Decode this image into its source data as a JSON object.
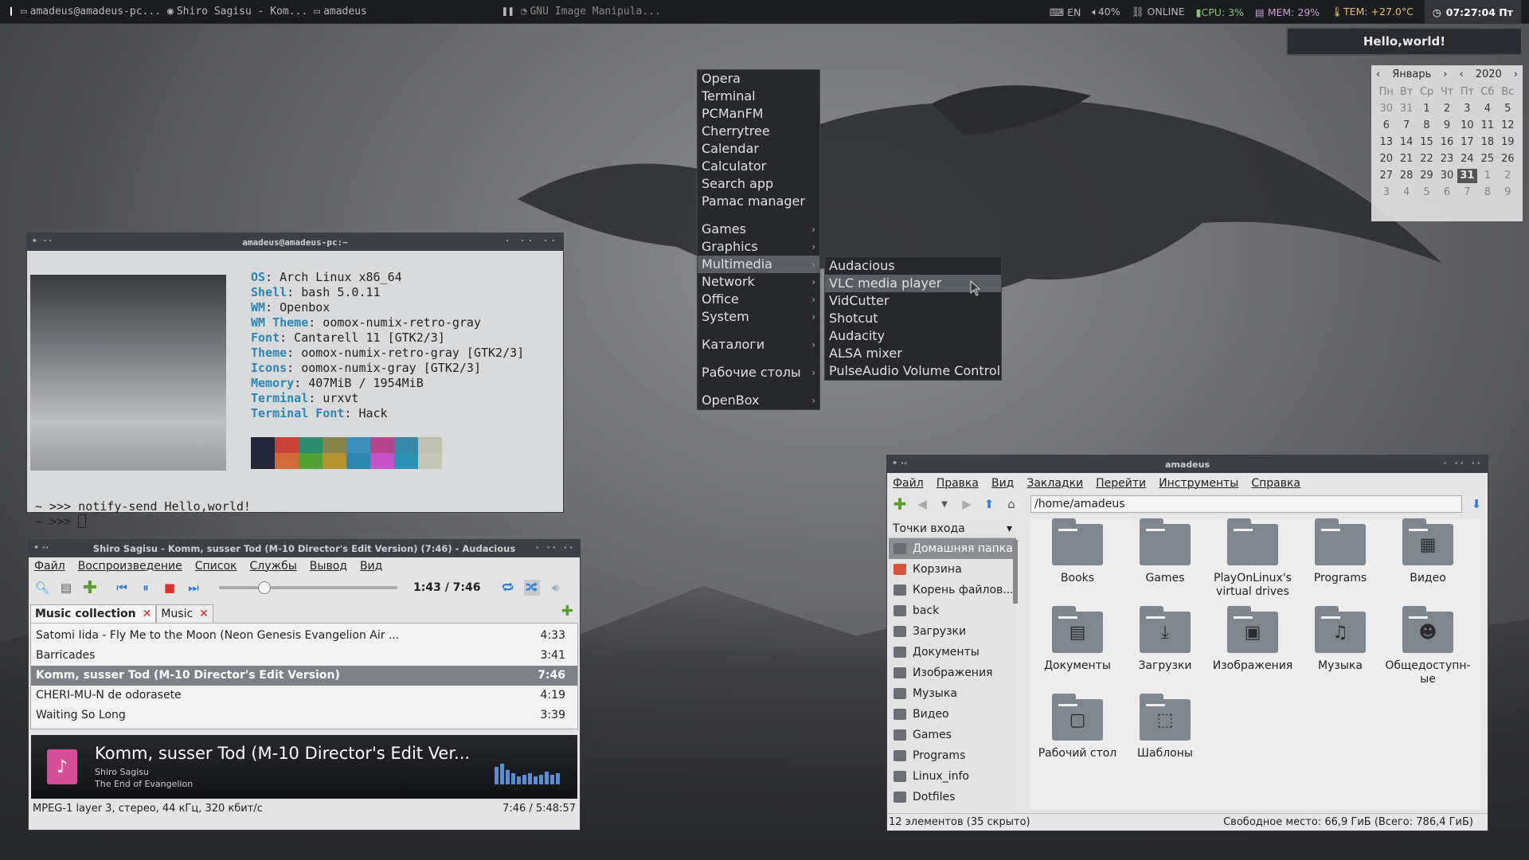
{
  "taskbar": {
    "tasks_left": [
      "amadeus@amadeus-pc...",
      "Shiro Sagisu - Kom...",
      "amadeus"
    ],
    "task_mid": "GNU Image Manipula...",
    "layout": "EN",
    "volume": "40%",
    "network": "ONLINE",
    "cpu": "CPU: 3%",
    "mem": "MEM: 29%",
    "temp": "TEM: +27.0°C",
    "clock": "07:27:04 Пт"
  },
  "notification": "Hello,world!",
  "calendar": {
    "month": "Январь",
    "year": "2020",
    "weekdays": [
      "Пн",
      "Вт",
      "Ср",
      "Чт",
      "Пт",
      "Сб",
      "Вс"
    ],
    "days": [
      "30",
      "31",
      "1",
      "2",
      "3",
      "4",
      "5",
      "6",
      "7",
      "8",
      "9",
      "10",
      "11",
      "12",
      "13",
      "14",
      "15",
      "16",
      "17",
      "18",
      "19",
      "20",
      "21",
      "22",
      "23",
      "24",
      "25",
      "26",
      "27",
      "28",
      "29",
      "30",
      "31",
      "1",
      "2",
      "3",
      "4",
      "5",
      "6",
      "7",
      "8",
      "9"
    ]
  },
  "menu": {
    "items": [
      "Opera",
      "Terminal",
      "PCManFM",
      "Cherrytree",
      "Calendar",
      "Calculator",
      "Search app",
      "Pamac manager"
    ],
    "categories": [
      "Games",
      "Graphics",
      "Multimedia",
      "Network",
      "Office",
      "System"
    ],
    "extra": [
      "Каталоги",
      "Рабочие столы"
    ],
    "openbox": "OpenBox",
    "submenu": [
      "Audacious",
      "VLC media player",
      "VidCutter",
      "Shotcut",
      "Audacity",
      "ALSA mixer",
      "PulseAudio Volume Control"
    ]
  },
  "terminal": {
    "title": "amadeus@amadeus-pc:~",
    "info": [
      {
        "k": "OS",
        "v": " Arch Linux x86_64"
      },
      {
        "k": "Shell",
        "v": " bash 5.0.11"
      },
      {
        "k": "WM",
        "v": " Openbox"
      },
      {
        "k": "WM Theme",
        "v": " oomox-numix-retro-gray"
      },
      {
        "k": "Font",
        "v": " Cantarell 11 [GTK2/3]"
      },
      {
        "k": "Theme",
        "v": " oomox-numix-retro-gray [GTK2/3]"
      },
      {
        "k": "Icons",
        "v": " oomox-numix-gray [GTK2/3]"
      },
      {
        "k": "Memory",
        "v": " 407MiB / 1954MiB"
      },
      {
        "k": "Terminal",
        "v": " urxvt"
      },
      {
        "k": "Terminal Font",
        "v": " Hack"
      }
    ],
    "swatch_colors": [
      "#24273a",
      "#c8423a",
      "#2f8a6e",
      "#87844c",
      "#3e8fb9",
      "#b4478c",
      "#3b87a6",
      "#bfc0b2",
      "#24273a",
      "#d16a3a",
      "#53a035",
      "#b5922f",
      "#2d88b0",
      "#c452c9",
      "#2c92b5",
      "#c6c6b7"
    ],
    "line1": "~ >>> notify-send Hello,world!",
    "line2": "~ >>> "
  },
  "audacious": {
    "title": "Shiro Sagisu - Komm, susser Tod (M-10 Director's Edit Version) (7:46) - Audacious",
    "menu": [
      "Файл",
      "Воспроизведение",
      "Список",
      "Службы",
      "Вывод",
      "Вид"
    ],
    "time": "1:43 / 7:46",
    "progress": 0.22,
    "tabs": [
      "Music collection",
      "Music"
    ],
    "playlist": [
      {
        "title": "Satomi Iida - Fly Me to the Moon (Neon Genesis Evangelion Air ...",
        "len": "4:33"
      },
      {
        "title": "Barricades",
        "len": "3:41"
      },
      {
        "title": "Komm, susser Tod (M-10 Director's Edit Version)",
        "len": "7:46"
      },
      {
        "title": "CHERI-MU-N de odorasete",
        "len": "4:19"
      },
      {
        "title": "Waiting So Long",
        "len": "3:39"
      }
    ],
    "np_title": "Komm, susser Tod (M-10 Director's Edit Ver...",
    "np_artist": "Shiro Sagisu",
    "np_album": "The End of Evangelion",
    "status_left": "MPEG-1 layer 3, стерео, 44 кГц, 320 кбит/с",
    "status_right": "7:46 / 5:48:57"
  },
  "fm": {
    "title": "amadeus",
    "menu": [
      "Файл",
      "Правка",
      "Вид",
      "Закладки",
      "Перейти",
      "Инструменты",
      "Справка"
    ],
    "path": "/home/amadeus",
    "side_title": "Точки входа",
    "side": [
      "Домашняя папка",
      "Корзина",
      "Корень файлов...",
      "back",
      "Загрузки",
      "Документы",
      "Изображения",
      "Музыка",
      "Видео",
      "Games",
      "Programs",
      "Linux_info",
      "Dotfiles"
    ],
    "items": [
      {
        "name": "Books",
        "icon": ""
      },
      {
        "name": "Games",
        "icon": ""
      },
      {
        "name": "PlayOnLinux's virtual drives",
        "icon": ""
      },
      {
        "name": "Programs",
        "icon": ""
      },
      {
        "name": "Видео",
        "icon": "▦"
      },
      {
        "name": "Документы",
        "icon": "▤"
      },
      {
        "name": "Загрузки",
        "icon": "⤓"
      },
      {
        "name": "Изображения",
        "icon": "▣"
      },
      {
        "name": "Музыка",
        "icon": "♫"
      },
      {
        "name": "Общедоступн-ые",
        "icon": "☻"
      },
      {
        "name": "Рабочий стол",
        "icon": "▢"
      },
      {
        "name": "Шаблоны",
        "icon": "⬚"
      }
    ],
    "status_left": "12 элементов (35 скрыто)",
    "status_right": "Свободное место: 66,9 ГиБ (Всего: 786,4 ГиБ)"
  }
}
